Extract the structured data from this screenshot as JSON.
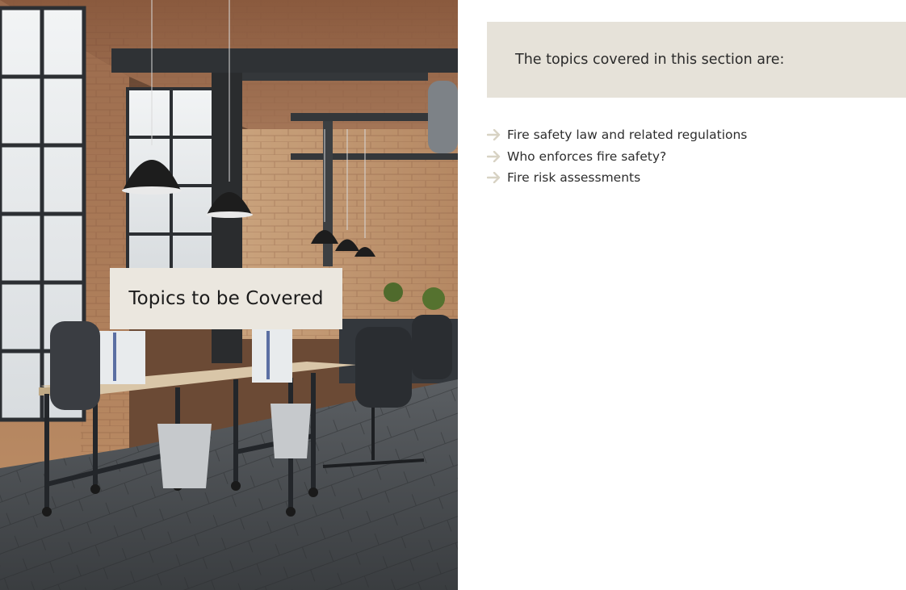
{
  "slide": {
    "title_card": "Topics to be Covered",
    "header": "The topics covered in this section are:",
    "topics": [
      {
        "label": "Fire safety law and related regulations",
        "icon": "arrow-right-icon"
      },
      {
        "label": "Who enforces fire safety?",
        "icon": "arrow-right-icon"
      },
      {
        "label": "Fire risk assessments",
        "icon": "arrow-right-icon"
      }
    ]
  },
  "colors": {
    "card_background": "#ebe7df",
    "header_background": "#e6e2d9",
    "bullet_arrow": "#d8d3c4",
    "text": "#2d2d2d"
  }
}
